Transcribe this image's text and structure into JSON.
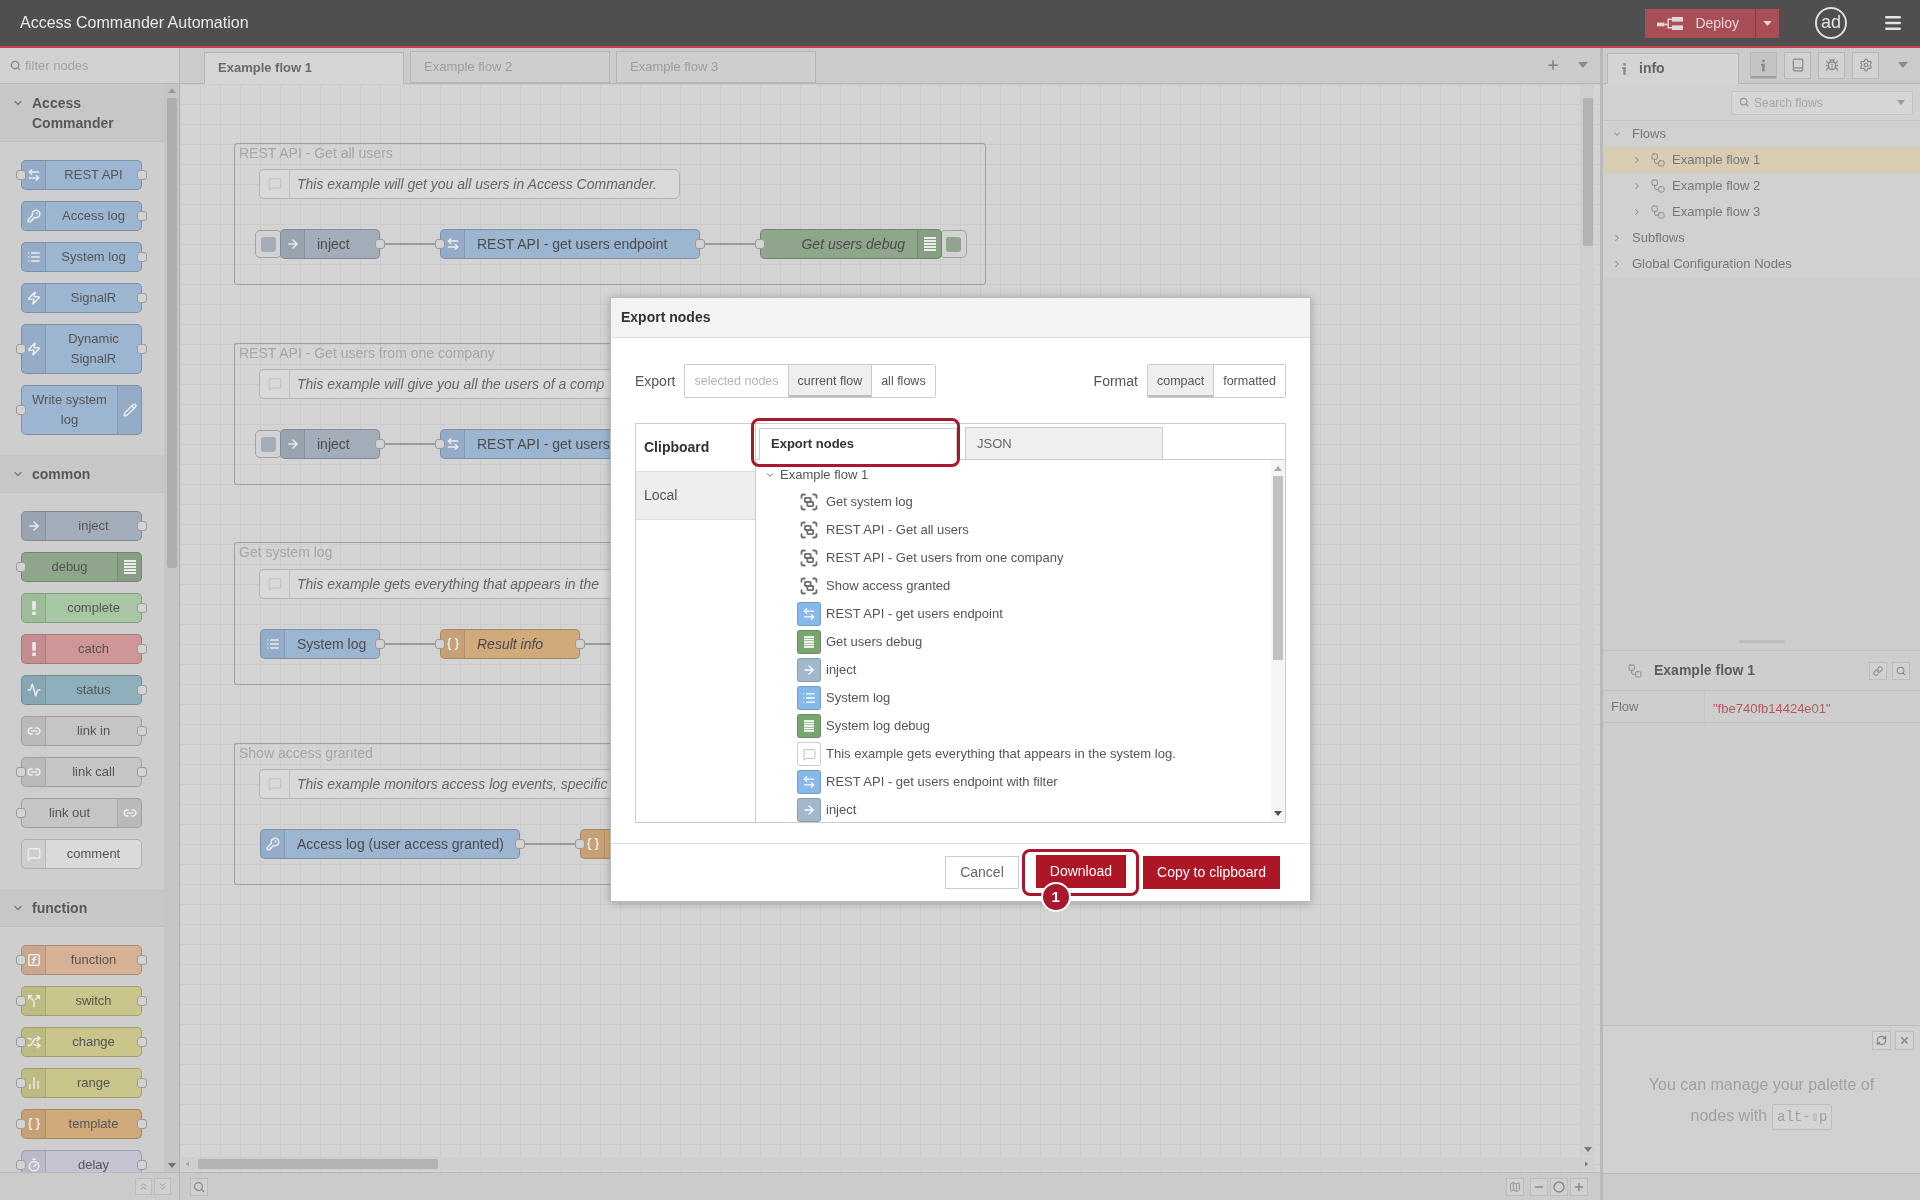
{
  "header": {
    "title": "Access Commander Automation",
    "deploy_label": "Deploy",
    "user_initials": "ad"
  },
  "palette": {
    "filter_placeholder": "filter nodes",
    "categories": [
      {
        "name": "Access Commander",
        "expanded": true,
        "nodes": [
          {
            "label": "REST API",
            "kind": "api"
          },
          {
            "label": "Access log",
            "kind": "accesslog"
          },
          {
            "label": "System log",
            "kind": "systemlog"
          },
          {
            "label": "SignalR",
            "kind": "signalr"
          },
          {
            "label": "Dynamic SignalR",
            "kind": "dynsignalr"
          },
          {
            "label": "Write system log",
            "kind": "writelog"
          }
        ]
      },
      {
        "name": "common",
        "expanded": true,
        "nodes": [
          {
            "label": "inject",
            "kind": "inject"
          },
          {
            "label": "debug",
            "kind": "debug"
          },
          {
            "label": "complete",
            "kind": "complete"
          },
          {
            "label": "catch",
            "kind": "catch"
          },
          {
            "label": "status",
            "kind": "status"
          },
          {
            "label": "link in",
            "kind": "linkin"
          },
          {
            "label": "link call",
            "kind": "linkcall"
          },
          {
            "label": "link out",
            "kind": "linkout"
          },
          {
            "label": "comment",
            "kind": "comment"
          }
        ]
      },
      {
        "name": "function",
        "expanded": true,
        "nodes": [
          {
            "label": "function",
            "kind": "function"
          },
          {
            "label": "switch",
            "kind": "switch"
          },
          {
            "label": "change",
            "kind": "change"
          },
          {
            "label": "range",
            "kind": "range"
          },
          {
            "label": "template",
            "kind": "template"
          },
          {
            "label": "delay",
            "kind": "delay"
          }
        ]
      }
    ]
  },
  "workspace": {
    "tabs": [
      {
        "label": "Example flow 1",
        "selected": true
      },
      {
        "label": "Example flow 2",
        "selected": false
      },
      {
        "label": "Example flow 3",
        "selected": false
      }
    ],
    "groups": [
      {
        "label": "REST API - Get all users",
        "comment": "This example will get you all users in Access Commander.",
        "nodes": [
          {
            "label": "inject",
            "kind": "inject",
            "italic": false
          },
          {
            "label": "REST API - get users endpoint",
            "kind": "api",
            "italic": false
          },
          {
            "label": "Get users debug",
            "kind": "debug",
            "italic": true
          }
        ]
      },
      {
        "label": "REST API - Get users from one company",
        "comment": "This example will give you all the users of a comp",
        "nodes": [
          {
            "label": "inject",
            "kind": "inject",
            "italic": false
          },
          {
            "label": "REST API - get users",
            "kind": "api",
            "italic": false
          }
        ]
      },
      {
        "label": "Get system log",
        "comment": "This example gets everything that appears in the",
        "nodes": [
          {
            "label": "System log",
            "kind": "systemlog",
            "italic": false
          },
          {
            "label": "Result info",
            "kind": "template",
            "italic": true
          }
        ]
      },
      {
        "label": "Show access granted",
        "comment": "This example monitors access log events, specific",
        "nodes": [
          {
            "label": "Access log (user access granted)",
            "kind": "accesslog",
            "italic": false
          },
          {
            "kind": "template"
          }
        ]
      }
    ]
  },
  "sidebar": {
    "tabs": [
      {
        "label": "info",
        "selected": true
      }
    ],
    "tool_buttons": [
      {
        "kind": "info",
        "selected": true
      },
      {
        "kind": "book",
        "selected": false
      },
      {
        "kind": "bug",
        "selected": false
      },
      {
        "kind": "settings",
        "selected": false
      }
    ],
    "search_placeholder": "Search flows",
    "tree": [
      {
        "label": "Flows",
        "expanded": true,
        "selected": false,
        "children": [
          {
            "label": "Example flow 1",
            "expanded": false,
            "selected": true
          },
          {
            "label": "Example flow 2",
            "expanded": false,
            "selected": false
          },
          {
            "label": "Example flow 3",
            "expanded": false,
            "selected": false
          }
        ]
      },
      {
        "label": "Subflows",
        "expanded": false,
        "selected": false
      },
      {
        "label": "Global Configuration Nodes",
        "expanded": false,
        "selected": false
      }
    ],
    "info": {
      "title": "Example flow 1",
      "properties": [
        {
          "key": "Flow",
          "value": "\"fbe740fb14424e01\""
        }
      ]
    },
    "palette_hint": {
      "text": "You can manage your palette of nodes with",
      "shortcut": "alt-⇧p"
    }
  },
  "export_dialog": {
    "title": "Export nodes",
    "export_label": "Export",
    "export_options": [
      {
        "label": "selected nodes",
        "selected": false,
        "disabled": true
      },
      {
        "label": "current flow",
        "selected": true,
        "disabled": false
      },
      {
        "label": "all flows",
        "selected": false,
        "disabled": false
      }
    ],
    "format_label": "Format",
    "format_options": [
      {
        "label": "compact",
        "selected": true
      },
      {
        "label": "formatted",
        "selected": false
      }
    ],
    "sources": [
      {
        "label": "Clipboard",
        "selected": true
      },
      {
        "label": "Local",
        "selected": false
      }
    ],
    "tabs": [
      {
        "label": "Export nodes",
        "selected": true,
        "highlighted": true
      },
      {
        "label": "JSON",
        "selected": false,
        "highlighted": false
      }
    ],
    "tree": [
      {
        "label": "Example flow 1",
        "expanded": true,
        "children": [
          {
            "label": "Get system log",
            "kind": "group"
          },
          {
            "label": "REST API - Get all users",
            "kind": "group"
          },
          {
            "label": "REST API - Get users from one company",
            "kind": "group"
          },
          {
            "label": "Show access granted",
            "kind": "group"
          },
          {
            "label": "REST API - get users endpoint",
            "kind": "api"
          },
          {
            "label": "Get users debug",
            "kind": "debug"
          },
          {
            "label": "inject",
            "kind": "inject"
          },
          {
            "label": "System log",
            "kind": "systemlog"
          },
          {
            "label": "System log debug",
            "kind": "debug"
          },
          {
            "label": "This example gets everything that appears in the system log.",
            "kind": "comment"
          },
          {
            "label": "REST API - get users endpoint with filter",
            "kind": "api"
          },
          {
            "label": "inject",
            "kind": "inject"
          }
        ]
      }
    ],
    "buttons": [
      {
        "label": "Cancel",
        "kind": "secondary",
        "highlighted": false
      },
      {
        "label": "Download",
        "kind": "primary",
        "highlighted": true,
        "step": "1"
      },
      {
        "label": "Copy to clipboard",
        "kind": "primary",
        "highlighted": false
      }
    ]
  }
}
